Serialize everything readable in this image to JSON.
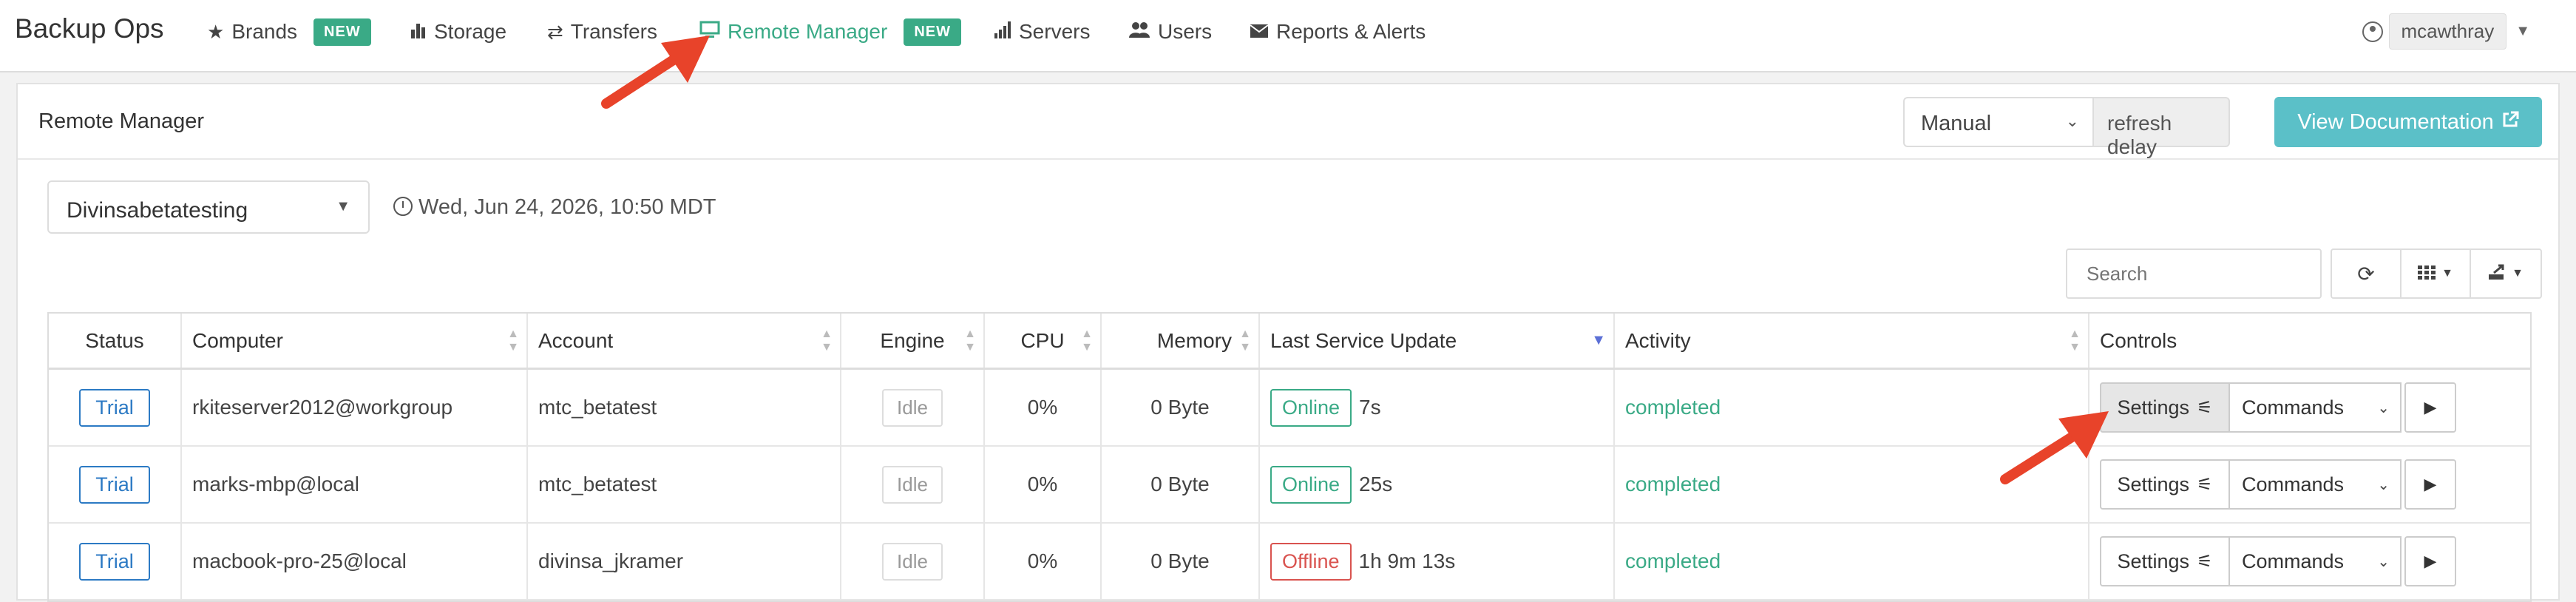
{
  "nav": {
    "brand": "Backup Ops",
    "items": [
      {
        "label": "Brands",
        "icon": "star-icon",
        "badge": "NEW"
      },
      {
        "label": "Storage",
        "icon": "bar-chart-icon"
      },
      {
        "label": "Transfers",
        "icon": "transfer-arrows-icon"
      },
      {
        "label": "Remote Manager",
        "icon": "monitor-icon",
        "badge": "NEW",
        "active": true
      },
      {
        "label": "Servers",
        "icon": "signal-bars-icon"
      },
      {
        "label": "Users",
        "icon": "users-icon"
      },
      {
        "label": "Reports & Alerts",
        "icon": "envelope-icon"
      }
    ],
    "user": "mcawthray"
  },
  "panel": {
    "title": "Remote Manager",
    "refresh_mode": "Manual",
    "refresh_addon": "refresh delay",
    "doc_button": "View Documentation"
  },
  "filters": {
    "company": "Divinsabetatesting",
    "datetime": "Wed, Jun 24, 2026, 10:50 MDT",
    "search_placeholder": "Search"
  },
  "table": {
    "columns": [
      "Status",
      "Computer",
      "Account",
      "Engine",
      "CPU",
      "Memory",
      "Last Service Update",
      "Activity",
      "Controls"
    ],
    "rows": [
      {
        "status": "Trial",
        "computer": "rkiteserver2012@workgroup",
        "account": "mtc_betatest",
        "engine": "Idle",
        "cpu": "0%",
        "memory": "0 Byte",
        "service": "Online",
        "service_time": "7s",
        "activity": "completed"
      },
      {
        "status": "Trial",
        "computer": "marks-mbp@local",
        "account": "mtc_betatest",
        "engine": "Idle",
        "cpu": "0%",
        "memory": "0 Byte",
        "service": "Online",
        "service_time": "25s",
        "activity": "completed"
      },
      {
        "status": "Trial",
        "computer": "macbook-pro-25@local",
        "account": "divinsa_jkramer",
        "engine": "Idle",
        "cpu": "0%",
        "memory": "0 Byte",
        "service": "Offline",
        "service_time": "1h 9m 13s",
        "activity": "completed"
      }
    ],
    "settings_label": "Settings",
    "commands_label": "Commands"
  },
  "colors": {
    "accent_green": "#3aaa86",
    "annotation_arrow": "#e8432a",
    "doc_button": "#5bc0c8",
    "trial_blue": "#2c7ac4",
    "offline_red": "#d9534f"
  }
}
